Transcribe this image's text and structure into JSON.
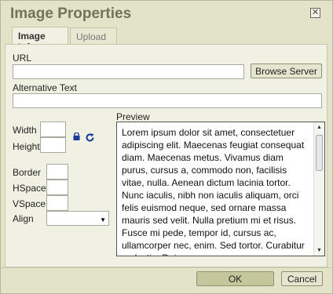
{
  "dialog": {
    "title": "Image Properties",
    "close_glyph": "✕"
  },
  "tabs": [
    {
      "label": "Image Info",
      "active": true
    },
    {
      "label": "Upload",
      "active": false
    }
  ],
  "form": {
    "url_label": "URL",
    "url_value": "",
    "browse_label": "Browse Server",
    "alt_label": "Alternative Text",
    "alt_value": "",
    "width_label": "Width",
    "width_value": "",
    "height_label": "Height",
    "height_value": "",
    "border_label": "Border",
    "border_value": "",
    "hspace_label": "HSpace",
    "hspace_value": "",
    "vspace_label": "VSpace",
    "vspace_value": "",
    "align_label": "Align",
    "align_value": ""
  },
  "preview": {
    "label": "Preview",
    "text": "Lorem ipsum dolor sit amet, consectetuer adipiscing elit. Maecenas feugiat consequat diam. Maecenas metus. Vivamus diam purus, cursus a, commodo non, facilisis vitae, nulla. Aenean dictum lacinia tortor. Nunc iaculis, nibh non iaculis aliquam, orci felis euismod neque, sed ornare massa mauris sed velit. Nulla pretium mi et risus. Fusce mi pede, tempor id, cursus ac, ullamcorper nec, enim. Sed tortor. Curabitur molestie. Duis"
  },
  "footer": {
    "ok_label": "OK",
    "cancel_label": "Cancel"
  },
  "icons": {
    "lock": "lock-icon",
    "reset": "reset-size-icon"
  },
  "colors": {
    "dialog_bg": "#e3e3c7",
    "panel_bg": "#f1f1e3",
    "title": "#737357",
    "ok_bg": "#c6c69c"
  }
}
